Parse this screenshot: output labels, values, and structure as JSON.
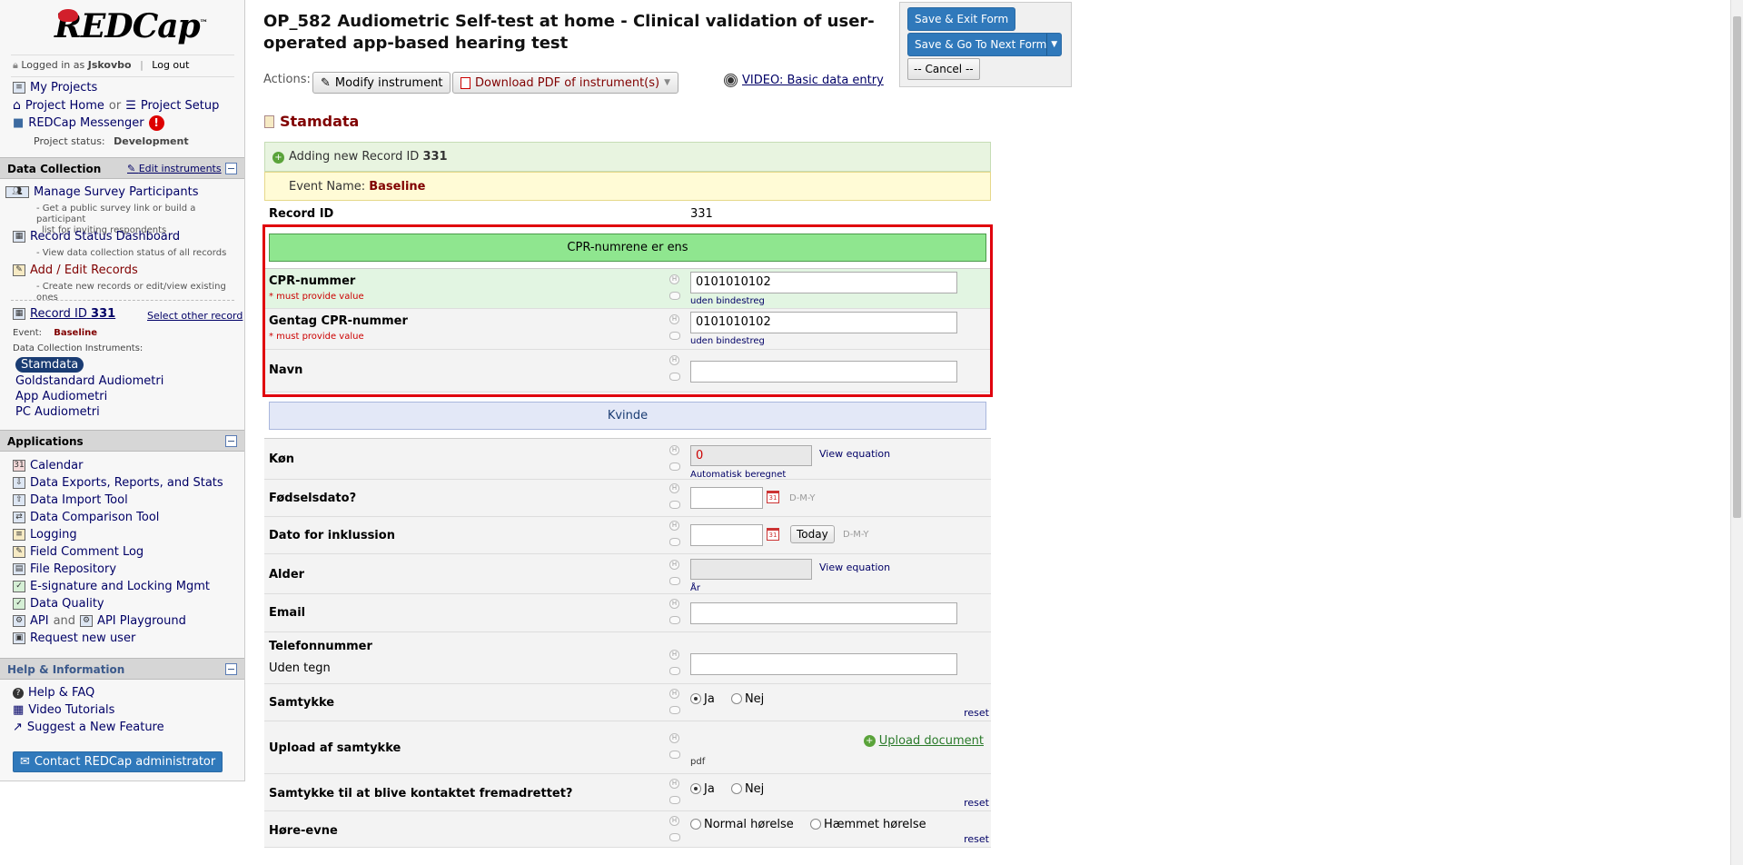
{
  "app": {
    "logo": "REDCap",
    "logo_tm": "™"
  },
  "user": {
    "logged_in_prefix": "Logged in as",
    "username": "Jskovbo",
    "separator": "|",
    "logout": "Log out"
  },
  "sidebar_nav": {
    "my_projects": "My Projects",
    "project_home": "Project Home",
    "or": "or",
    "project_setup": "Project Setup",
    "messenger": "REDCap Messenger",
    "status_label": "Project status:",
    "status_value": "Development"
  },
  "data_collection": {
    "heading": "Data Collection",
    "edit_instruments": "Edit instruments",
    "manage_survey": "Manage Survey Participants",
    "manage_survey_desc1": "- Get a public survey link or build a participant",
    "manage_survey_desc2": "list for inviting respondents",
    "record_status": "Record Status Dashboard",
    "record_status_desc": "- View data collection status of all records",
    "add_edit": "Add / Edit Records",
    "add_edit_desc": "- Create new records or edit/view existing ones",
    "record_prefix": "Record ID",
    "record_id": "331",
    "select_other": "Select other record",
    "event_label": "Event:",
    "event_value": "Baseline",
    "instruments_label": "Data Collection Instruments:",
    "instruments": [
      "Stamdata",
      "Goldstandard Audiometri",
      "App Audiometri",
      "PC Audiometri"
    ]
  },
  "applications": {
    "heading": "Applications",
    "items": [
      "Calendar",
      "Data Exports, Reports, and Stats",
      "Data Import Tool",
      "Data Comparison Tool",
      "Logging",
      "Field Comment Log",
      "File Repository",
      "E-signature and Locking Mgmt",
      "Data Quality"
    ],
    "api": "API",
    "and": "and",
    "api_playground": "API Playground",
    "request_user": "Request new user"
  },
  "help": {
    "heading": "Help & Information",
    "items": [
      "Help & FAQ",
      "Video Tutorials",
      "Suggest a New Feature"
    ],
    "contact": "Contact REDCap administrator"
  },
  "header": {
    "title": "OP_582 Audiometric Self-test at home - Clinical validation of user-operated app-based hearing test",
    "actions_label": "Actions:",
    "modify": "Modify instrument",
    "download_pdf": "Download PDF of instrument(s)",
    "video": "VIDEO: Basic data entry"
  },
  "save": {
    "exit": "Save & Exit Form",
    "next": "Save & Go To Next Form",
    "cancel": "-- Cancel --"
  },
  "form": {
    "instrument": "Stamdata",
    "adding_prefix": "Adding new Record ID",
    "adding_id": "331",
    "event_prefix": "Event Name:",
    "event_name": "Baseline",
    "record_id_label": "Record ID",
    "record_id_value": "331",
    "cpr_match": "CPR-numrene er ens",
    "must_provide": "* must provide value",
    "cpr_label": "CPR-nummer",
    "cpr_value": "0101010102",
    "cpr_note": "uden bindestreg",
    "cpr2_label": "Gentag CPR-nummer",
    "cpr2_value": "0101010102",
    "navn_label": "Navn",
    "kvinde": "Kvinde",
    "kon_label": "Køn",
    "kon_value": "0",
    "view_equation": "View equation",
    "auto_calc": "Automatisk beregnet",
    "fodsel_label": "Fødselsdato?",
    "date_format": "D-M-Y",
    "inklus_label": "Dato for inklussion",
    "today": "Today",
    "alder_label": "Alder",
    "alder_unit": "År",
    "email_label": "Email",
    "tlf_label": "Telefonnummer",
    "tlf_sub": "Uden tegn",
    "samtykke_label": "Samtykke",
    "ja": "Ja",
    "nej": "Nej",
    "reset": "reset",
    "upload_label": "Upload af samtykke",
    "upload_doc": "Upload document",
    "pdf": "pdf",
    "kontakt_label": "Samtykke til at blive kontaktet fremadrettet?",
    "hore_label": "Høre-evne",
    "normal": "Normal hørelse",
    "haemmet": "Hæmmet hørelse"
  },
  "colors": {
    "accent_blue": "#3079bb",
    "highlight_red": "#e0000d",
    "green_banner": "#8fe68f",
    "dark_red": "#800000"
  }
}
